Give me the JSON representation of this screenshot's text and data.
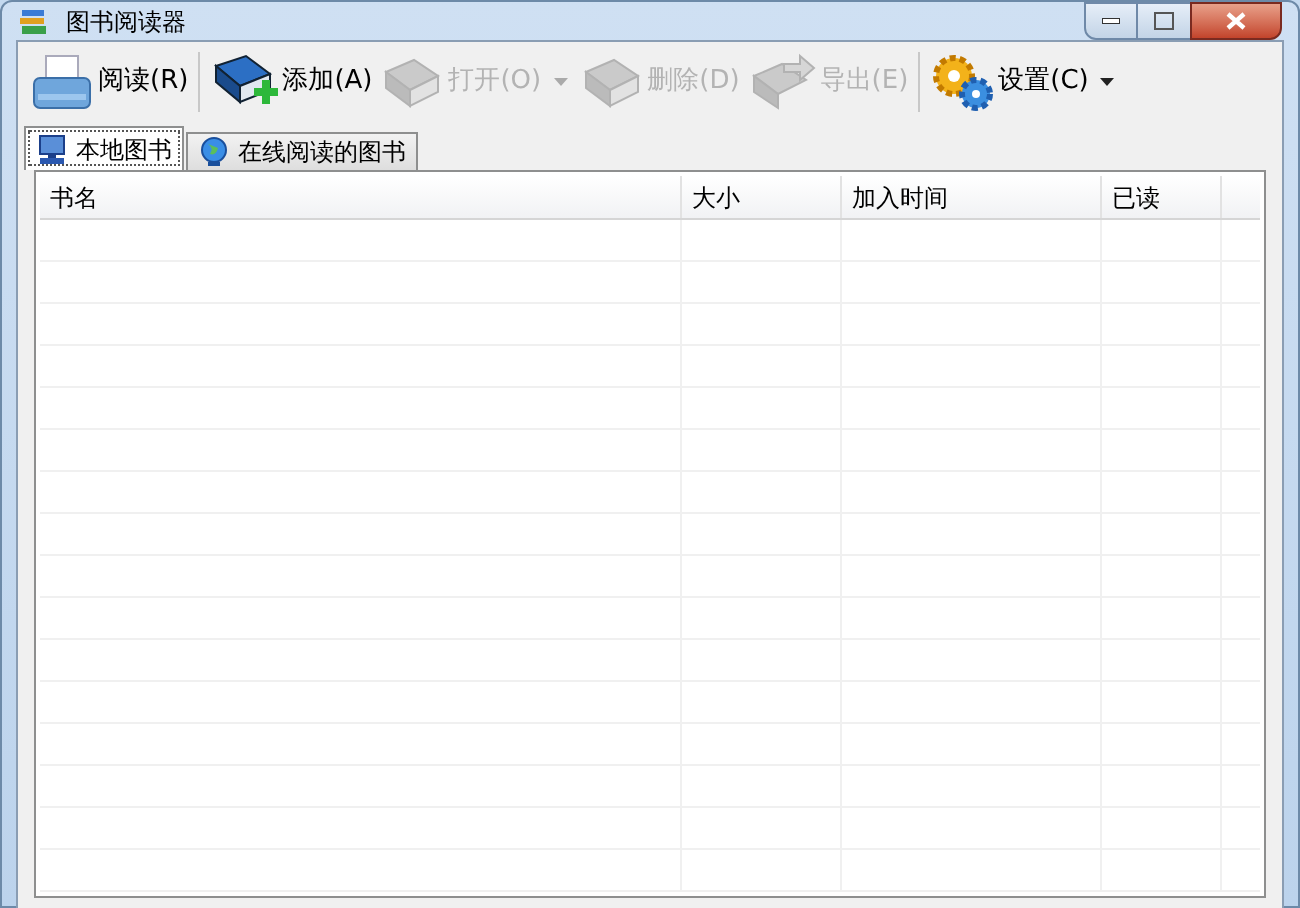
{
  "window": {
    "title": "图书阅读器"
  },
  "toolbar": [
    {
      "label": "阅读(R)",
      "kind": "printer",
      "disabled": false,
      "dropdown": false
    },
    {
      "label": "添加(A)",
      "kind": "bookadd",
      "disabled": false,
      "dropdown": false
    },
    {
      "label": "打开(O)",
      "kind": "book",
      "disabled": true,
      "dropdown": true
    },
    {
      "label": "删除(D)",
      "kind": "book",
      "disabled": true,
      "dropdown": false
    },
    {
      "label": "导出(E)",
      "kind": "export",
      "disabled": true,
      "dropdown": false
    },
    {
      "label": "设置(C)",
      "kind": "gears",
      "disabled": false,
      "dropdown": true
    }
  ],
  "tabs": [
    {
      "label": "本地图书",
      "kind": "computer",
      "selected": true
    },
    {
      "label": "在线阅读的图书",
      "kind": "globe",
      "selected": false
    }
  ],
  "table": {
    "columns": [
      "书名",
      "大小",
      "加入时间",
      "已读"
    ]
  }
}
